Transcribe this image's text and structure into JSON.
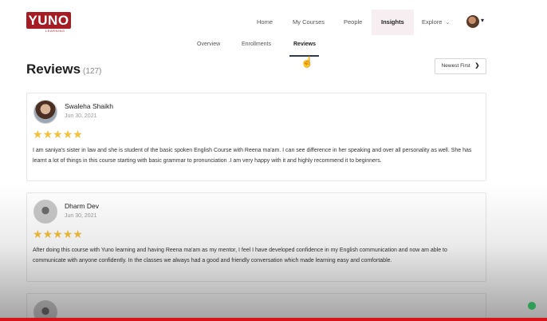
{
  "brand": {
    "name": "YUNO",
    "tagline": "LEARNING"
  },
  "nav": {
    "items": [
      {
        "label": "Home"
      },
      {
        "label": "My Courses"
      },
      {
        "label": "People"
      },
      {
        "label": "Insights"
      },
      {
        "label": "Explore"
      }
    ],
    "active": "Insights"
  },
  "subtabs": {
    "items": [
      {
        "label": "Overview"
      },
      {
        "label": "Enrollments"
      },
      {
        "label": "Reviews"
      }
    ],
    "active": "Reviews"
  },
  "header": {
    "title": "Reviews",
    "count": "(127)"
  },
  "sort": {
    "label": "Newest First"
  },
  "reviews": [
    {
      "name": "Swaleha Shaikh",
      "date": "Jun 30, 2021",
      "rating": 5,
      "text": "I am saniya's sister in law and she is student of the basic spoken English Course with Reena ma'am. I can see difference in her speaking and over all personality as well. She has learnt a lot of things in this course starting with basic grammar to pronunciation .I am very happy with it and highly recommend it to beginners."
    },
    {
      "name": "Dharm Dev",
      "date": "Jun 30, 2021",
      "rating": 5,
      "text": "After doing this course with Yuno learning and having Reena ma'am as my mentor, I feel I have developed confidence in my English communication and now am able to communicate with anyone confidently. In the classes we always had a good and friendly conversation which made learning easy and comfortable."
    }
  ],
  "colors": {
    "brand": "#a51c24",
    "star": "#f5c13b",
    "accent_underline": "#2d3b55"
  },
  "icons": {
    "star": "star-icon",
    "chevron": "chevron-down-icon",
    "cursor": "hand-pointer-icon"
  }
}
